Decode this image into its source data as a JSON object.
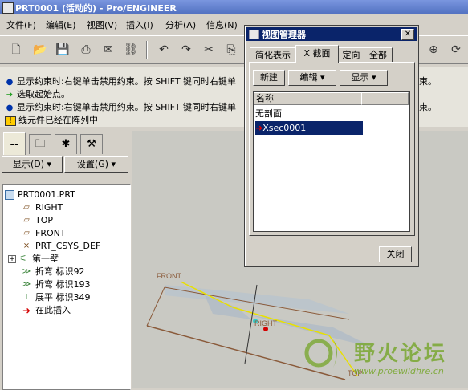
{
  "window": {
    "title": "PRT0001 (活动的) - Pro/ENGINEER"
  },
  "menubar": [
    "文件(F)",
    "编辑(E)",
    "视图(V)",
    "插入(I)",
    "分析(A)",
    "信息(N)"
  ],
  "messages": [
    "显示约束时:右键单击禁用约束。按 SHIFT 键同时右键单",
    "选取起始点。",
    "显示约束时:右键单击禁用约束。按 SHIFT 键同时右键单",
    "线元件已经在阵列中"
  ],
  "messages_right": [
    "束。",
    "束。"
  ],
  "navigator": {
    "show_label": "显示(D)",
    "settings_label": "设置(G)",
    "tree": [
      {
        "label": "PRT0001.PRT",
        "icon": "part-icon"
      },
      {
        "label": "RIGHT",
        "icon": "datum-plane-icon"
      },
      {
        "label": "TOP",
        "icon": "datum-plane-icon"
      },
      {
        "label": "FRONT",
        "icon": "datum-plane-icon"
      },
      {
        "label": "PRT_CSYS_DEF",
        "icon": "csys-icon"
      },
      {
        "label": "第一壁",
        "icon": "wall-icon"
      },
      {
        "label": "折弯 标识92",
        "icon": "bend-icon"
      },
      {
        "label": "折弯 标识193",
        "icon": "bend-icon"
      },
      {
        "label": "展平 标识349",
        "icon": "unbend-icon"
      },
      {
        "label": "在此插入",
        "icon": "insert-here-arrow-icon"
      }
    ]
  },
  "dialog": {
    "title": "视图管理器",
    "tabs": [
      "简化表示",
      "X 截面",
      "定向",
      "全部"
    ],
    "active_tab": "X 截面",
    "buttons": {
      "new": "新建",
      "edit": "编辑",
      "show": "显示"
    },
    "list_header": "名称",
    "list_items": [
      "无剖面",
      "Xsec0001"
    ],
    "selected_item": "Xsec0001",
    "close": "关闭"
  },
  "viewport": {
    "labels": {
      "front": "FRONT",
      "right": "RIGHT",
      "top": "TOP"
    }
  },
  "watermark": {
    "text": "野火论坛",
    "url": "www.proewildfire.cn"
  },
  "colors": {
    "title_bar": "#0a246a",
    "selection": "#0a246a",
    "window_bg": "#d4d0c8",
    "part_edge": "#8a5a3a",
    "sketch_line": "#e8e000"
  }
}
